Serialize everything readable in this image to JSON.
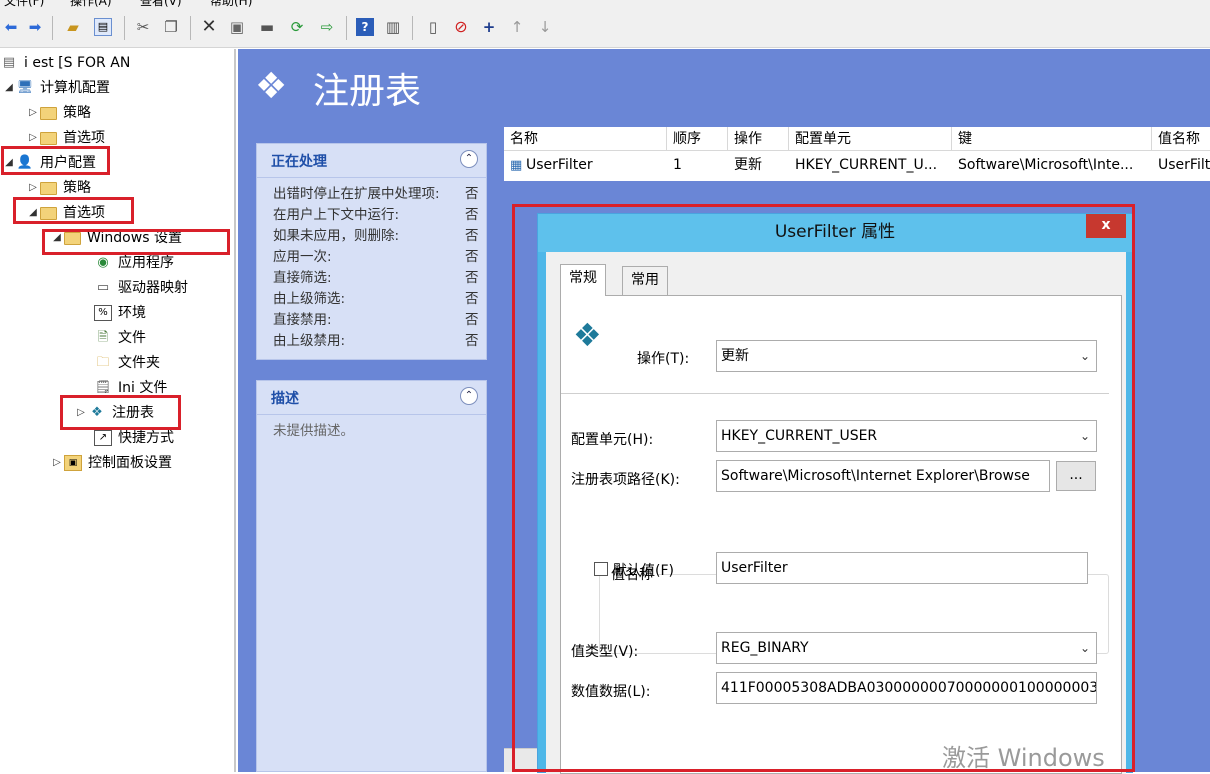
{
  "menubar": {
    "items": [
      "文件(F)",
      "操作(A)",
      "查看(V)",
      "帮助(H)"
    ]
  },
  "toolbar": {
    "icons": [
      "back-arrow-icon",
      "forward-arrow-icon",
      "folder-up-icon",
      "show-hide-tree-icon",
      "cut-icon",
      "copy-icon",
      "delete-icon",
      "properties-icon",
      "print-icon",
      "refresh-icon",
      "export-icon",
      "help-icon",
      "show-hide-action-pane-icon",
      "new-document-icon",
      "stop-icon",
      "add-icon",
      "move-up-icon",
      "move-down-icon"
    ]
  },
  "tree": {
    "root_label": "i     est [S     FOR         AN",
    "computer_config": "计算机配置",
    "cc_policy": "策略",
    "cc_prefs": "首选项",
    "user_config": "用户配置",
    "uc_policy": "策略",
    "uc_prefs": "首选项",
    "windows_settings": "Windows 设置",
    "items": [
      "应用程序",
      "驱动器映射",
      "环境",
      "文件",
      "文件夹",
      "Ini 文件",
      "注册表",
      "快捷方式"
    ],
    "control_panel": "控制面板设置"
  },
  "header": {
    "title": "注册表"
  },
  "processing_panel": {
    "title": "正在处理",
    "rows": [
      {
        "label": "出错时停止在扩展中处理项:",
        "value": "否"
      },
      {
        "label": "在用户上下文中运行:",
        "value": "否"
      },
      {
        "label": "如果未应用，则删除:",
        "value": "否"
      },
      {
        "label": "应用一次:",
        "value": "否"
      },
      {
        "label": "直接筛选:",
        "value": "否"
      },
      {
        "label": "由上级筛选:",
        "value": "否"
      },
      {
        "label": "直接禁用:",
        "value": "否"
      },
      {
        "label": "由上级禁用:",
        "value": "否"
      }
    ]
  },
  "description_panel": {
    "title": "描述",
    "text": "未提供描述。"
  },
  "list": {
    "headers": [
      "名称",
      "顺序",
      "操作",
      "配置单元",
      "键",
      "值名称"
    ],
    "row": [
      "UserFilter",
      "1",
      "更新",
      "HKEY_CURRENT_U...",
      "Software\\Microsoft\\Inte...",
      "UserFilt"
    ]
  },
  "dialog": {
    "title": "UserFilter 属性",
    "close": "x",
    "tabs": [
      "常规",
      "常用"
    ],
    "action_label": "操作(T):",
    "action_value": "更新",
    "hive_label": "配置单元(H):",
    "hive_value": "HKEY_CURRENT_USER",
    "keypath_label": "注册表项路径(K):",
    "keypath_value": "Software\\Microsoft\\Internet Explorer\\Browse",
    "browse_button": "...",
    "value_name_group": "值名称",
    "default_checkbox": "默认值(F)",
    "value_name": "UserFilter",
    "value_type_label": "值类型(V):",
    "value_type": "REG_BINARY",
    "value_data_label": "数值数据(L):",
    "value_data": "411F00005308ADBA03000000070000000100000003"
  },
  "watermark": "激活 Windows",
  "colors": {
    "accent": "#6a86d6",
    "highlight": "#d9202a",
    "dialog_frame": "#5ec1ec",
    "panel": "#d7e0f6"
  }
}
